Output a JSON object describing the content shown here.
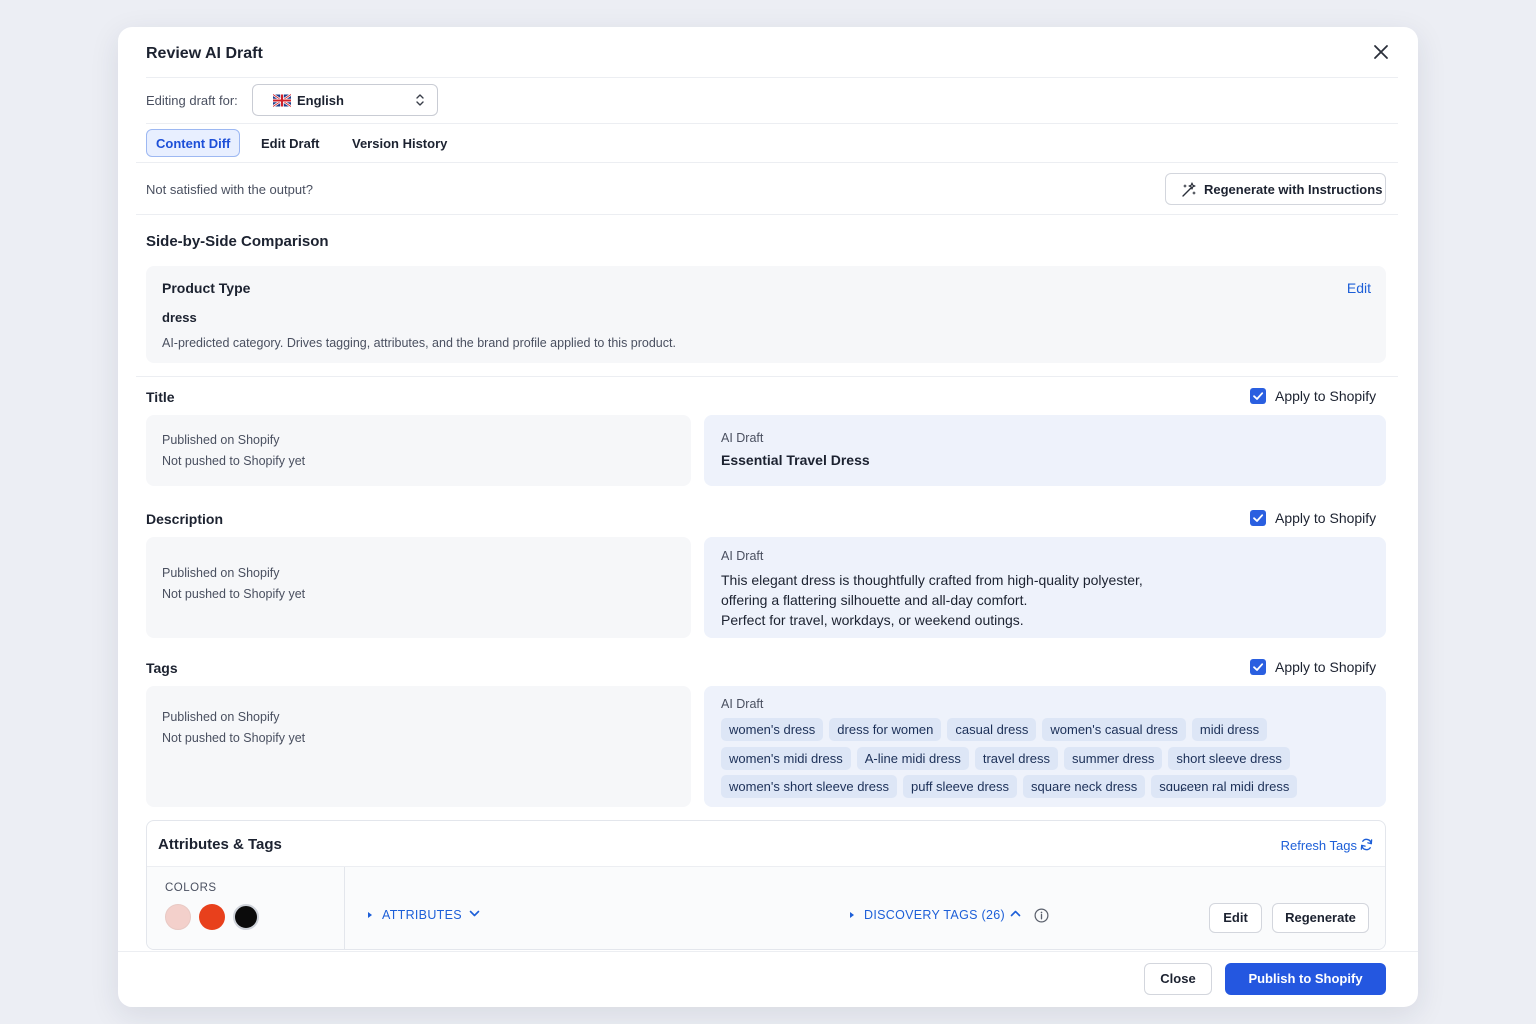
{
  "modal": {
    "title": "Review AI Draft"
  },
  "language": {
    "label": "Editing draft for:",
    "selected": "English",
    "flag_icon": "uk-flag-icon"
  },
  "tabs": [
    {
      "label": "Content Diff",
      "active": true
    },
    {
      "label": "Edit Draft",
      "active": false
    },
    {
      "label": "Version History",
      "active": false
    }
  ],
  "notice": {
    "text": "Not satisfied with the output?",
    "regenerate_label": "Regenerate with Instructions",
    "regenerate_icon": "sparkle-icon"
  },
  "comparison": {
    "heading": "Side-by-Side Comparison"
  },
  "product_type": {
    "title": "Product Type",
    "edit_label": "Edit",
    "value": "dress",
    "description": "AI-predicted category. Drives tagging, attributes, and the brand profile applied to this product."
  },
  "fields": {
    "title": {
      "label": "Title",
      "apply_label": "Apply to Shopify",
      "apply_checked": true,
      "published_label": "Published on Shopify",
      "published_value": "Not pushed to Shopify yet",
      "ai_label": "AI Draft",
      "ai_value": "Essential Travel Dress"
    },
    "description": {
      "label": "Description",
      "apply_label": "Apply to Shopify",
      "apply_checked": true,
      "published_label": "Published on Shopify",
      "published_value": "Not pushed to Shopify yet",
      "ai_label": "AI Draft",
      "ai_lines": [
        "This elegant dress is thoughtfully crafted from high-quality polyester,",
        "offering a flattering silhouette and all-day comfort.",
        "Perfect for travel, workdays, or weekend outings."
      ]
    },
    "tags": {
      "label": "Tags",
      "apply_label": "Apply to Shopify",
      "apply_checked": true,
      "published_label": "Published on Shopify",
      "published_value": "Not pushed to Shopify yet",
      "ai_label": "AI Draft",
      "rows": [
        [
          "women's dress",
          "dress for women",
          "casual dress",
          "women's casual dress",
          "midi dress"
        ],
        [
          "women's midi dress",
          "A-line midi dress",
          "travel dress",
          "summer dress",
          "short sleeve dress"
        ],
        [
          "women's short sleeve dress",
          "puff sleeve dress",
          "square neck dress",
          "sɑuɕeɐn ral midi dress"
        ]
      ]
    }
  },
  "attributes": {
    "title": "Attributes & Tags",
    "refresh_label": "Refresh Tags",
    "colors_label": "COLORS",
    "colors": [
      "#f3d0cb",
      "#e8401c",
      "#0b0b0b"
    ],
    "attributes_label": "ATTRIBUTES",
    "discovery_label": "DISCOVERY TAGS (26)",
    "edit_label": "Edit",
    "regenerate_label": "Regenerate"
  },
  "footer": {
    "close_label": "Close",
    "publish_label": "Publish to Shopify"
  }
}
